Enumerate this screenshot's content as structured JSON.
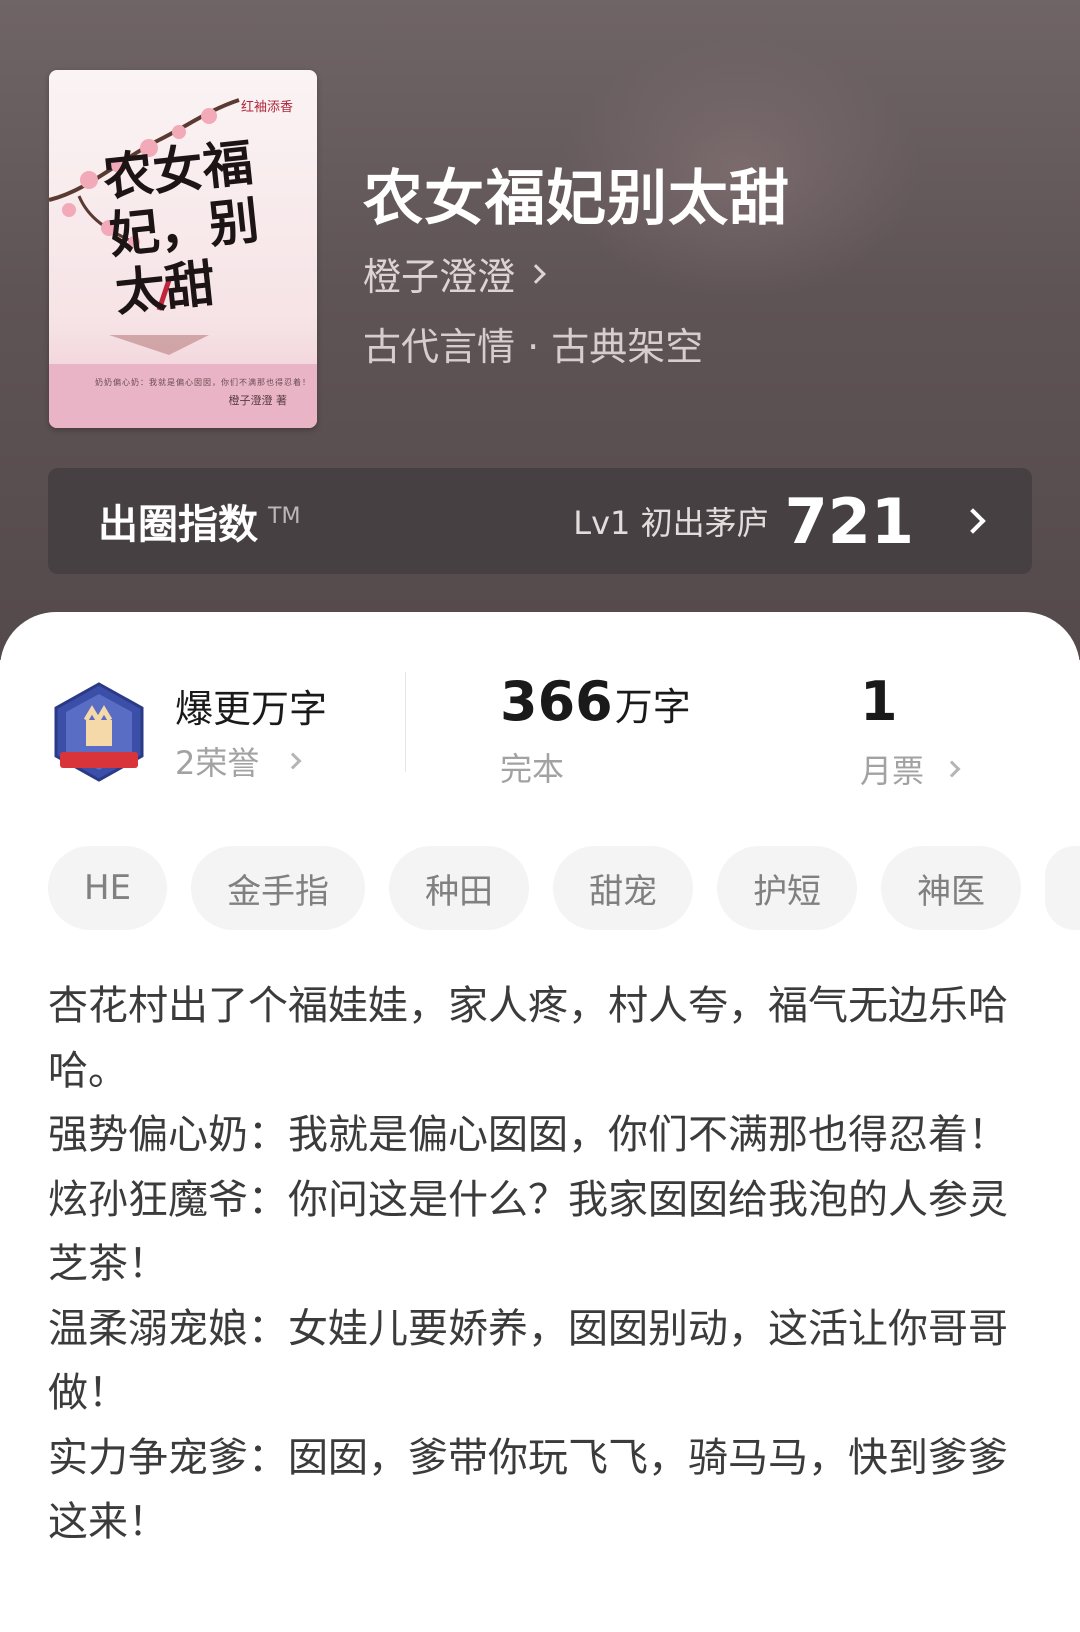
{
  "book": {
    "title": "农女福妃别太甜",
    "author": "橙子澄澄",
    "genre": "古代言情 · 古典架空"
  },
  "cover": {
    "title": "农女福妃，别太甜",
    "publisher": "红袖添香",
    "author": "橙子澄澄 著",
    "blurb": "奶奶偏心奶：我就是偏心囡囡，你们不满那也得忍着！"
  },
  "index": {
    "label": "出圈指数",
    "tm": "TM",
    "level": "Lv1 初出茅庐",
    "score": "721"
  },
  "stats": {
    "honor_title": "爆更万字",
    "honor_sub": "2荣誉",
    "words_num": "366",
    "words_unit": "万字",
    "words_sub": "完本",
    "ticket_num": "1",
    "ticket_sub": "月票"
  },
  "tags": [
    "HE",
    "金手指",
    "种田",
    "甜宠",
    "护短",
    "神医"
  ],
  "synopsis": [
    "杏花村出了个福娃娃，家人疼，村人夸，福气无边乐哈哈。",
    "强势偏心奶：我就是偏心囡囡，你们不满那也得忍着！",
    "炫孙狂魔爷：你问这是什么？我家囡囡给我泡的人参灵芝茶！",
    "温柔溺宠娘：女娃儿要娇养，囡囡别动，这活让你哥哥做！",
    "实力争宠爹：囡囡，爹带你玩飞飞，骑马马，快到爹爹这来！"
  ],
  "colors": {
    "hero_bg": "#5e5355",
    "index_bar": "#474042",
    "badge_blue": "#3c4fa8",
    "badge_red": "#d8343a"
  }
}
